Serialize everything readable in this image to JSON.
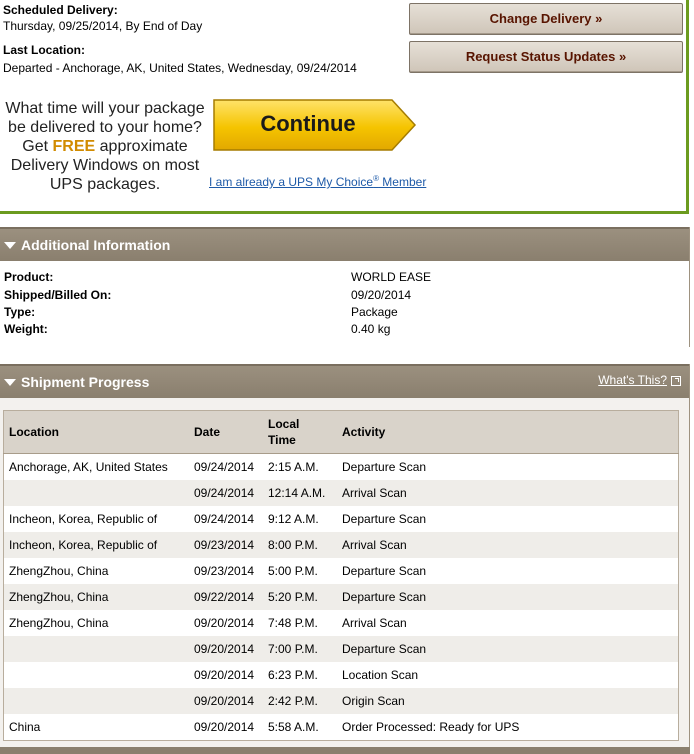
{
  "delivery": {
    "scheduled_label": "Scheduled Delivery:",
    "scheduled_value": "Thursday, 09/25/2014, By End of Day",
    "last_location_label": "Last Location:",
    "last_location_value": "Departed - Anchorage, AK, United States, Wednesday, 09/24/2014"
  },
  "actions": {
    "change_delivery": "Change Delivery »",
    "request_updates": "Request Status Updates »"
  },
  "promo": {
    "line1": "What time will your package be delivered to your home? Get ",
    "free": "FREE",
    "line2": " approximate Delivery Windows on most UPS packages.",
    "continue_label": "Continue",
    "link_text": "I am already a UPS My Choice",
    "link_sup": "®",
    "link_suffix": " Member",
    "accent_color": "#f5c400"
  },
  "additional_info": {
    "title": "Additional Information",
    "rows": [
      {
        "label": "Product:",
        "value": "WORLD EASE"
      },
      {
        "label": "Shipped/Billed On:",
        "value": "09/20/2014"
      },
      {
        "label": "Type:",
        "value": "Package"
      },
      {
        "label": "Weight:",
        "value": "0.40 kg"
      }
    ]
  },
  "shipment_progress": {
    "title": "Shipment Progress",
    "whats_this": "What's This?",
    "columns": [
      "Location",
      "Date",
      "Local Time",
      "Activity"
    ],
    "rows": [
      {
        "location": "Anchorage, AK, United States",
        "date": "09/24/2014",
        "time": "2:15 A.M.",
        "activity": "Departure Scan"
      },
      {
        "location": "",
        "date": "09/24/2014",
        "time": "12:14 A.M.",
        "activity": "Arrival Scan"
      },
      {
        "location": "Incheon, Korea, Republic of",
        "date": "09/24/2014",
        "time": "9:12 A.M.",
        "activity": "Departure Scan"
      },
      {
        "location": "Incheon, Korea, Republic of",
        "date": "09/23/2014",
        "time": "8:00 P.M.",
        "activity": "Arrival Scan"
      },
      {
        "location": "ZhengZhou, China",
        "date": "09/23/2014",
        "time": "5:00 P.M.",
        "activity": "Departure Scan"
      },
      {
        "location": "ZhengZhou, China",
        "date": "09/22/2014",
        "time": "5:20 P.M.",
        "activity": "Departure Scan"
      },
      {
        "location": "ZhengZhou, China",
        "date": "09/20/2014",
        "time": "7:48 P.M.",
        "activity": "Arrival Scan"
      },
      {
        "location": "",
        "date": "09/20/2014",
        "time": "7:00 P.M.",
        "activity": "Departure Scan"
      },
      {
        "location": "",
        "date": "09/20/2014",
        "time": "6:23 P.M.",
        "activity": "Location Scan"
      },
      {
        "location": "",
        "date": "09/20/2014",
        "time": "2:42 P.M.",
        "activity": "Origin Scan"
      },
      {
        "location": "China",
        "date": "09/20/2014",
        "time": "5:58 A.M.",
        "activity": "Order Processed: Ready for UPS"
      }
    ]
  }
}
